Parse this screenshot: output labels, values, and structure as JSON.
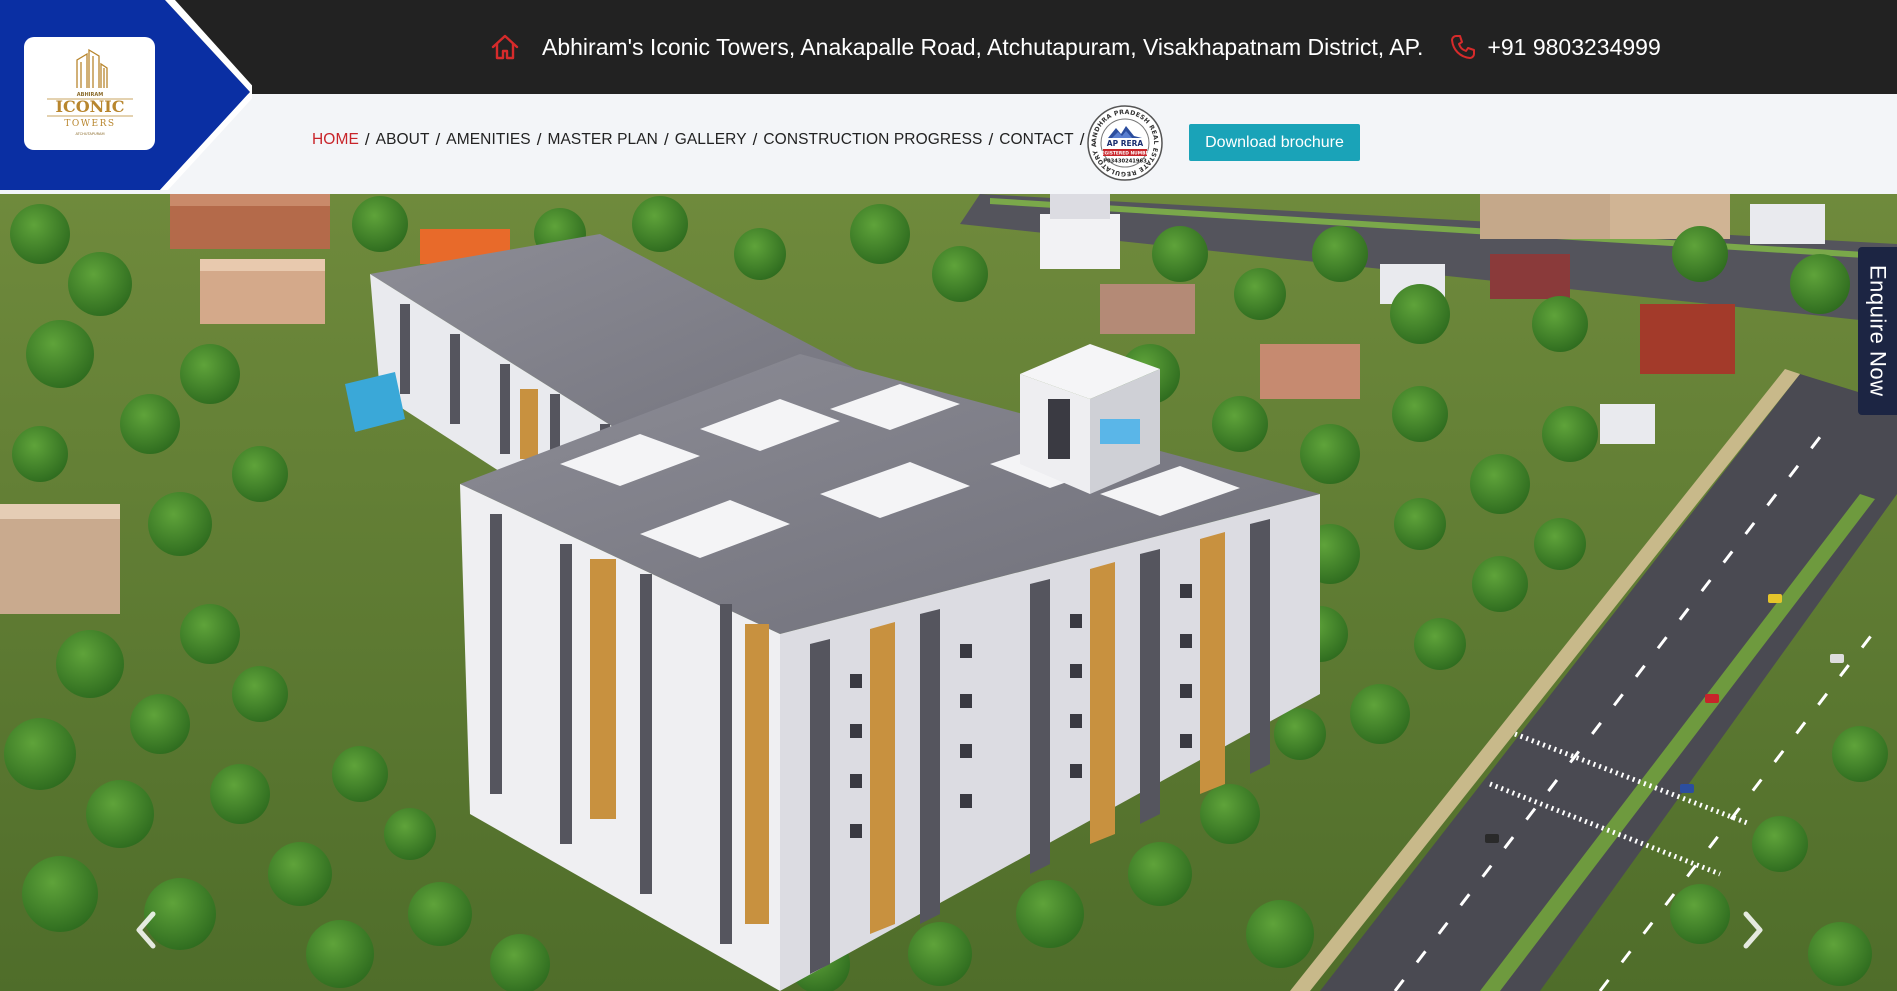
{
  "topbar": {
    "address": "Abhiram's Iconic Towers, Anakapalle Road, Atchutapuram, Visakhapatnam District, AP.",
    "phone": "+91 9803234999",
    "home_icon": "home-icon",
    "phone_icon": "phone-icon"
  },
  "logo": {
    "brand_top": "ABHIRAM",
    "brand_main": "ICONIC",
    "brand_sub": "TOWERS",
    "brand_place": "ATCHUTAPURAM"
  },
  "nav": {
    "items": [
      {
        "label": "HOME",
        "active": true
      },
      {
        "label": "ABOUT",
        "active": false
      },
      {
        "label": "AMENITIES",
        "active": false
      },
      {
        "label": "MASTER PLAN",
        "active": false
      },
      {
        "label": "GALLERY",
        "active": false
      },
      {
        "label": "CONSTRUCTION PROGRESS",
        "active": false
      },
      {
        "label": "CONTACT",
        "active": false
      }
    ],
    "separator": "/"
  },
  "rera": {
    "ring_text": "ANDHRA PRADESH REAL ESTATE REGULATORY AUTHORITY",
    "title": "AP RERA",
    "registered": "REGISTERED NUMBER",
    "number": "P03430241963"
  },
  "download_button": "Download brochure",
  "enquire": "Enquire Now",
  "colors": {
    "topbar_bg": "#222222",
    "brand_blue": "#0a2fa3",
    "accent_red": "#c8242a",
    "button_teal": "#1aa3b8",
    "enquire_bg": "#1c2543",
    "logo_gold": "#b8862e"
  },
  "hero": {
    "prev_icon": "chevron-left-icon",
    "next_icon": "chevron-right-icon"
  }
}
